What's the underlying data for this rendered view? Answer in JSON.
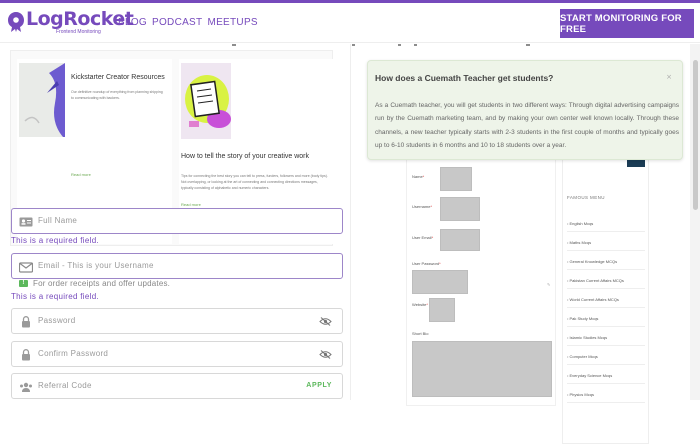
{
  "brand": {
    "name": "LogRocket",
    "tagline": "Frontend Monitoring",
    "color": "#764abc"
  },
  "nav": {
    "links": [
      "BLOG",
      "PODCAST",
      "MEETUPS"
    ],
    "cta": "START MONITORING FOR FREE"
  },
  "cards": [
    {
      "title": "Kickstarter Creator Resources",
      "body": "Our definitive roundup of everything from planning shipping to communicating with backers.",
      "link": "Read more"
    },
    {
      "title": "How to tell the story of your creative work",
      "body": "Tips for connecting the best story you can tell to press, funders, followers and more (body tips). Not overlapping, or looking at the art of connecting and connecting directions messages, typically consisting of alphabetic and numeric characters.",
      "link": "Read more"
    }
  ],
  "form": {
    "full_name_placeholder": "Full Name",
    "email_placeholder": "Email - This is your Username",
    "password_placeholder": "Password",
    "confirm_password_placeholder": "Confirm Password",
    "referral_placeholder": "Referral Code",
    "apply_label": "APPLY",
    "required_error": "This is a required field.",
    "email_hint": "For order receipts and offer updates."
  },
  "qa": {
    "question": "How does a Cuemath Teacher get students?",
    "close": "×",
    "answer": "As a Cuemath teacher, you will get students in two different ways: Through digital advertising campaigns run by the Cuemath marketing team, and by making your own center well known locally. Through these channels, a new teacher typically starts with 2-3 students in the first couple of months and typically goes up to 6-10 students in 6 months and 10 to 18 students over a year."
  },
  "embedded_form": {
    "labels": [
      "Name",
      "Username",
      "User Email",
      "User Password",
      "Website",
      "Short Bio"
    ]
  },
  "sidebar": {
    "top_text": "Ideas for Google",
    "menu_title": "FAMOUS MENU",
    "items": [
      "English Mcqs",
      "Maths Mcqs",
      "General Knowledge MCQs",
      "Pakistan Current Affairs MCQs",
      "World Current Affairs MCQs",
      "Pak Study Mcqs",
      "Islamic Studies Mcqs",
      "Computer Mcqs",
      "Everyday Science Mcqs",
      "Physics Mcqs"
    ]
  }
}
